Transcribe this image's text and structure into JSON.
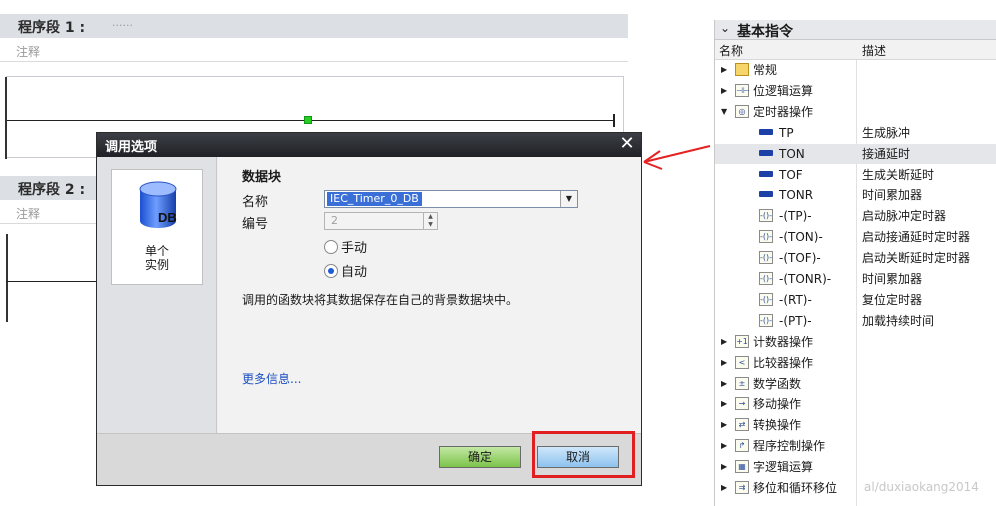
{
  "editor": {
    "network1": {
      "title": "程序段 1 :",
      "dots": "......",
      "comment": "注释"
    },
    "network2": {
      "title": "程序段 2 :",
      "comment": "注释"
    }
  },
  "dialog": {
    "title": "调用选项",
    "close_icon": "close-icon",
    "instance_label_line1": "单个",
    "instance_label_line2": "实例",
    "db_icon_text": "DB",
    "section_title": "数据块",
    "name_label": "名称",
    "name_value": "IEC_Timer_0_DB",
    "number_label": "编号",
    "number_value": "2",
    "radio_manual": "手动",
    "radio_auto": "自动",
    "selected_mode": "auto",
    "description": "调用的函数块将其数据保存在自己的背景数据块中。",
    "more_info": "更多信息...",
    "ok": "确定",
    "cancel": "取消"
  },
  "panel": {
    "title": "基本指令",
    "col_name": "名称",
    "col_desc": "描述",
    "items": [
      {
        "level": 0,
        "expanded": false,
        "icon": "folder-icon",
        "glyph": "",
        "name": "常规",
        "desc": ""
      },
      {
        "level": 0,
        "expanded": false,
        "icon": "bit-logic-icon",
        "glyph": "⊣⊢",
        "name": "位逻辑运算",
        "desc": ""
      },
      {
        "level": 0,
        "expanded": true,
        "icon": "timer-icon",
        "glyph": "◎",
        "name": "定时器操作",
        "desc": ""
      },
      {
        "level": 1,
        "icon": "block-icon",
        "glyph": "",
        "name": "TP",
        "desc": "生成脉冲"
      },
      {
        "level": 1,
        "icon": "block-icon",
        "glyph": "",
        "name": "TON",
        "desc": "接通延时",
        "selected": true
      },
      {
        "level": 1,
        "icon": "block-icon",
        "glyph": "",
        "name": "TOF",
        "desc": "生成关断延时"
      },
      {
        "level": 1,
        "icon": "block-icon",
        "glyph": "",
        "name": "TONR",
        "desc": "时间累加器"
      },
      {
        "level": 1,
        "icon": "coil-icon",
        "glyph": "-()-",
        "name": "-(TP)-",
        "desc": "启动脉冲定时器"
      },
      {
        "level": 1,
        "icon": "coil-icon",
        "glyph": "-()-",
        "name": "-(TON)-",
        "desc": "启动接通延时定时器"
      },
      {
        "level": 1,
        "icon": "coil-icon",
        "glyph": "-()-",
        "name": "-(TOF)-",
        "desc": "启动关断延时定时器"
      },
      {
        "level": 1,
        "icon": "coil-icon",
        "glyph": "-()-",
        "name": "-(TONR)-",
        "desc": "时间累加器"
      },
      {
        "level": 1,
        "icon": "coil-icon",
        "glyph": "-()-",
        "name": "-(RT)-",
        "desc": "复位定时器"
      },
      {
        "level": 1,
        "icon": "coil-icon",
        "glyph": "-()-",
        "name": "-(PT)-",
        "desc": "加载持续时间"
      },
      {
        "level": 0,
        "expanded": false,
        "icon": "counter-icon",
        "glyph": "+1",
        "name": "计数器操作",
        "desc": ""
      },
      {
        "level": 0,
        "expanded": false,
        "icon": "comparator-icon",
        "glyph": "<",
        "name": "比较器操作",
        "desc": ""
      },
      {
        "level": 0,
        "expanded": false,
        "icon": "math-icon",
        "glyph": "±",
        "name": "数学函数",
        "desc": ""
      },
      {
        "level": 0,
        "expanded": false,
        "icon": "move-icon",
        "glyph": "→",
        "name": "移动操作",
        "desc": ""
      },
      {
        "level": 0,
        "expanded": false,
        "icon": "convert-icon",
        "glyph": "⇄",
        "name": "转换操作",
        "desc": ""
      },
      {
        "level": 0,
        "expanded": false,
        "icon": "program-control-icon",
        "glyph": "↱",
        "name": "程序控制操作",
        "desc": ""
      },
      {
        "level": 0,
        "expanded": false,
        "icon": "word-logic-icon",
        "glyph": "▦",
        "name": "字逻辑运算",
        "desc": ""
      },
      {
        "level": 0,
        "expanded": false,
        "icon": "shift-icon",
        "glyph": "⇉",
        "name": "移位和循环移位",
        "desc": ""
      }
    ]
  },
  "watermark": "al/duxiaokang2014"
}
